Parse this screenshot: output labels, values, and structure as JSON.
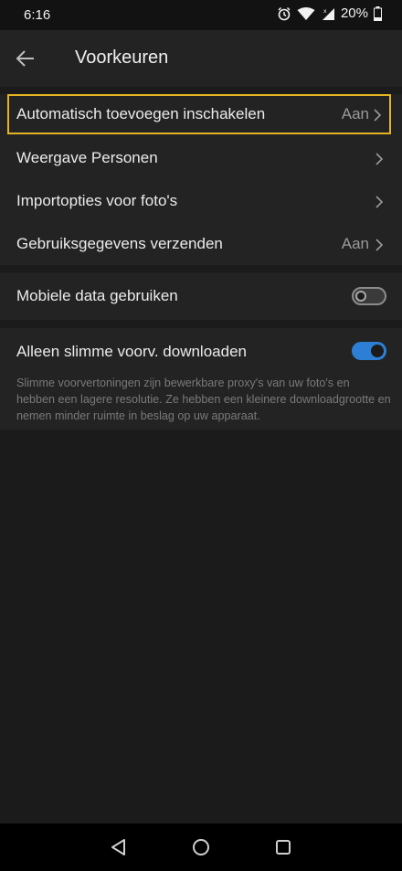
{
  "status_bar": {
    "time": "6:16",
    "battery": "20%",
    "icons": [
      "alarm-icon",
      "wifi-icon",
      "signal-icon",
      "battery-icon"
    ]
  },
  "app_bar": {
    "title": "Voorkeuren",
    "back_icon": "arrow-left-icon"
  },
  "settings": {
    "rows": [
      {
        "label": "Automatisch toevoegen inschakelen",
        "value": "Aan"
      },
      {
        "label": "Weergave Personen",
        "value": ""
      },
      {
        "label": "Importopties voor foto's",
        "value": ""
      },
      {
        "label": "Gebruiksgegevens verzenden",
        "value": "Aan"
      }
    ],
    "mobile_data": {
      "label": "Mobiele data gebruiken",
      "enabled": false
    },
    "smart_previews": {
      "label": "Alleen slimme voorv. downloaden",
      "enabled": true,
      "description": "Slimme voorvertoningen zijn bewerkbare proxy's van uw foto's en hebben een lagere resolutie. Ze hebben een kleinere downloadgrootte en nemen minder ruimte in beslag op uw apparaat."
    }
  },
  "nav_bar": {
    "buttons": [
      "back-triangle-icon",
      "home-circle-icon",
      "recents-square-icon"
    ]
  },
  "colors": {
    "highlight": "#e6b422",
    "toggle_on": "#2d7fd6",
    "background": "#1b1b1b",
    "surface": "#232323"
  }
}
